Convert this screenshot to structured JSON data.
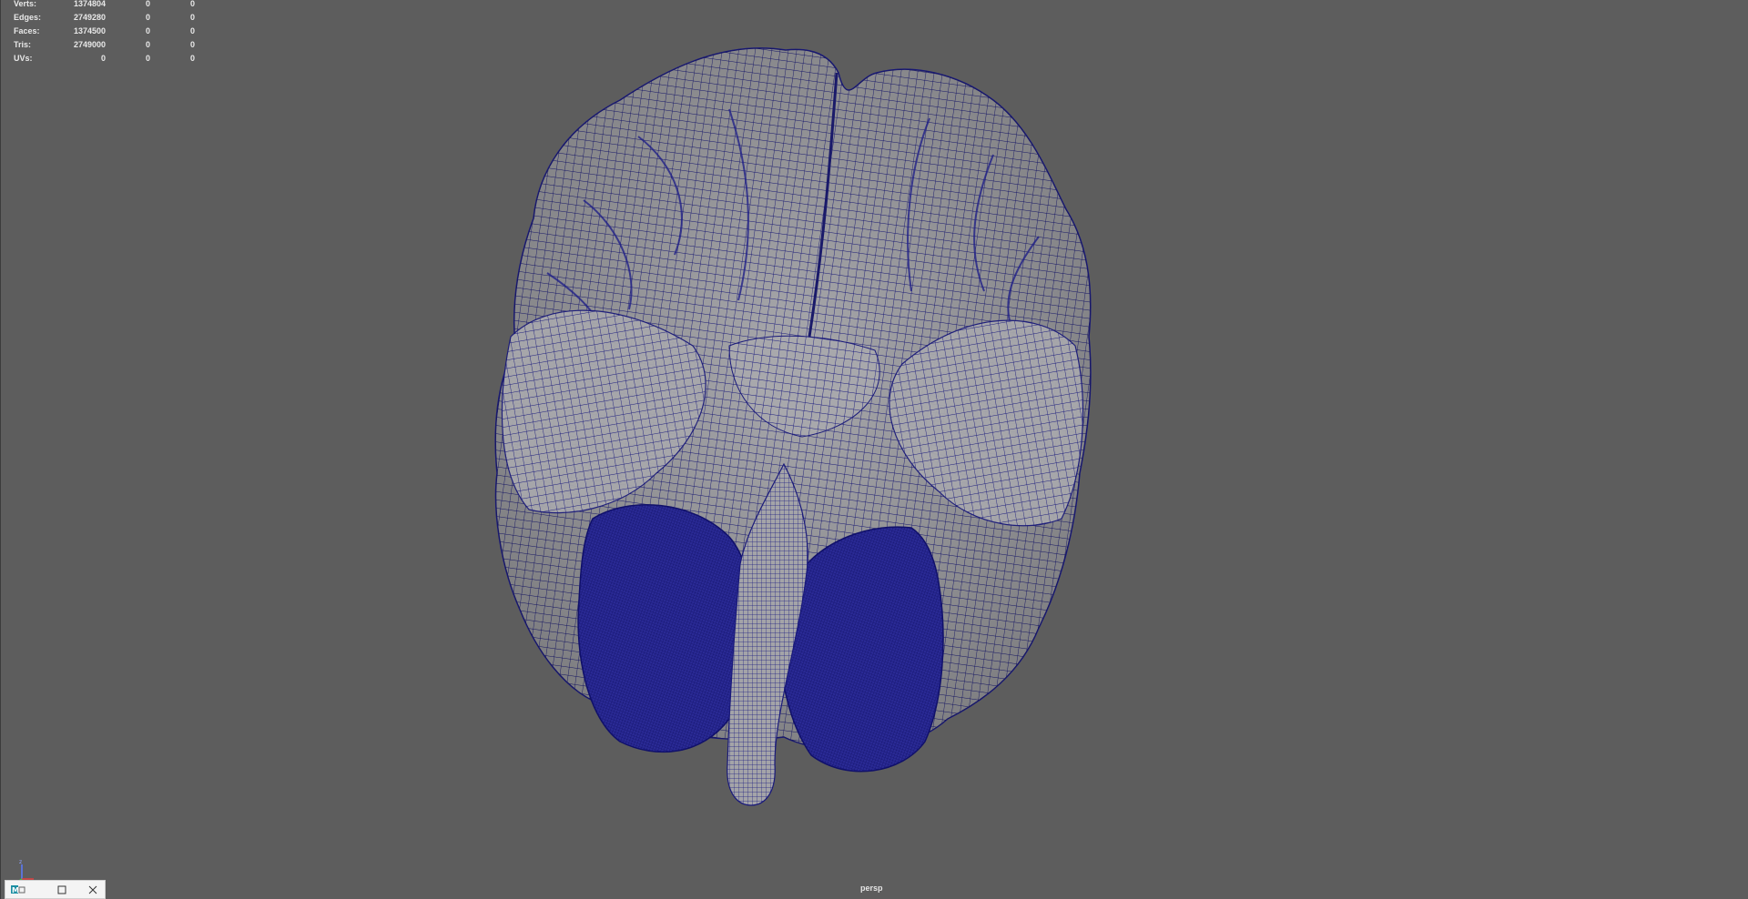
{
  "hud": {
    "rows": [
      {
        "label": "Verts:",
        "v1": "1374804",
        "v2": "0",
        "v3": "0"
      },
      {
        "label": "Edges:",
        "v1": "2749280",
        "v2": "0",
        "v3": "0"
      },
      {
        "label": "Faces:",
        "v1": "1374500",
        "v2": "0",
        "v3": "0"
      },
      {
        "label": "Tris:",
        "v1": "2749000",
        "v2": "0",
        "v3": "0"
      },
      {
        "label": "UVs:",
        "v1": "0",
        "v2": "0",
        "v3": "0"
      }
    ]
  },
  "viewport": {
    "camera": "persp",
    "background_color": "#5d5d5d",
    "mesh_fill_color": "#a6a6aa",
    "wire_color": "#1a1a7a"
  },
  "icons": {
    "axis": "axis-gizmo-icon",
    "app": "maya-app-icon",
    "maximize": "maximize-icon",
    "close": "close-icon"
  }
}
